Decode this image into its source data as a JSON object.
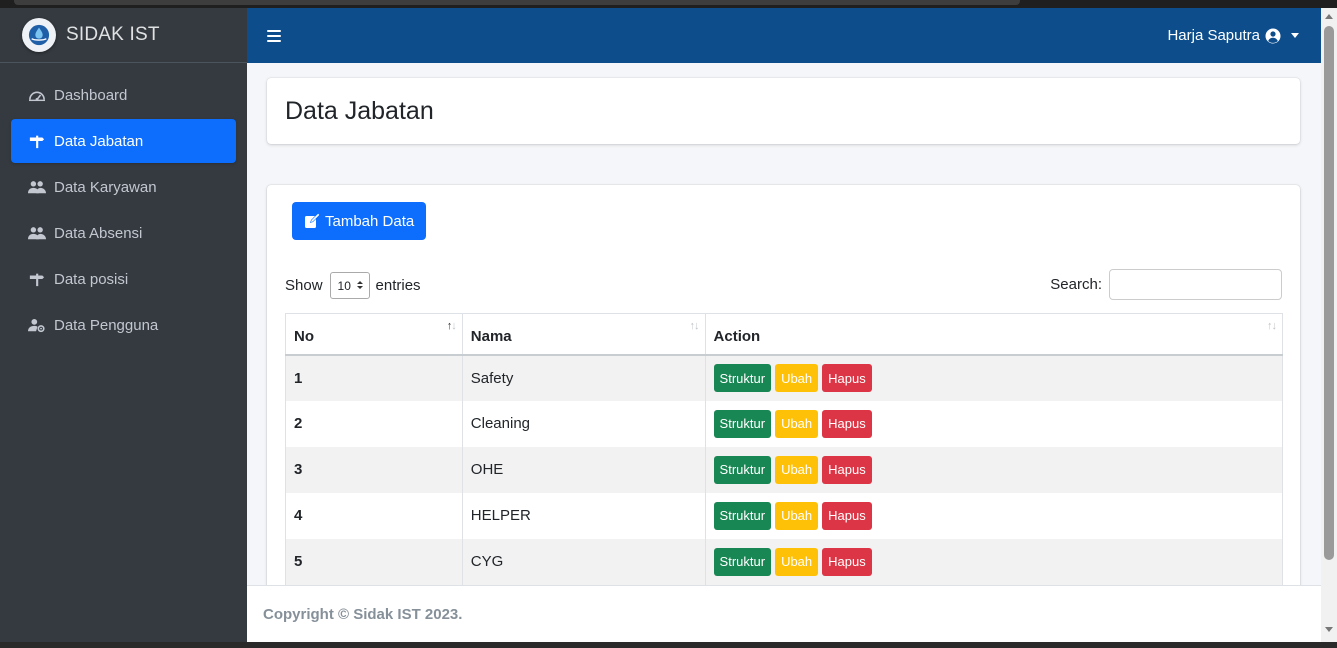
{
  "app": {
    "brand": "SIDAK IST"
  },
  "sidebar": {
    "items": [
      {
        "label": "Dashboard",
        "icon": "dashboard-gauge-icon",
        "active": false
      },
      {
        "label": "Data Jabatan",
        "icon": "signpost-icon",
        "active": true
      },
      {
        "label": "Data Karyawan",
        "icon": "users-icon",
        "active": false
      },
      {
        "label": "Data Absensi",
        "icon": "users-icon",
        "active": false
      },
      {
        "label": "Data posisi",
        "icon": "signpost-icon",
        "active": false
      },
      {
        "label": "Data Pengguna",
        "icon": "user-gear-icon",
        "active": false
      }
    ]
  },
  "header": {
    "user_name": "Harja Saputra"
  },
  "page": {
    "title": "Data Jabatan"
  },
  "toolbar": {
    "add_label": "Tambah Data"
  },
  "table_controls": {
    "show_label": "Show",
    "entries_value": "10",
    "entries_label": "entries",
    "search_label": "Search:",
    "search_value": ""
  },
  "table": {
    "columns": [
      "No",
      "Nama",
      "Action"
    ],
    "sort_glyph": "↑↓",
    "rows": [
      {
        "no": "1",
        "nama": "Safety"
      },
      {
        "no": "2",
        "nama": "Cleaning"
      },
      {
        "no": "3",
        "nama": "OHE"
      },
      {
        "no": "4",
        "nama": "HELPER"
      },
      {
        "no": "5",
        "nama": "CYG"
      }
    ],
    "actions": {
      "struktur": "Struktur",
      "ubah": "Ubah",
      "hapus": "Hapus"
    }
  },
  "footer": {
    "text": "Copyright © Sidak IST 2023."
  },
  "colors": {
    "sidebar_bg": "#343a40",
    "header_bg": "#0d4d8c",
    "primary": "#0d6efd",
    "success": "#198754",
    "warning": "#ffc107",
    "danger": "#dc3545"
  }
}
